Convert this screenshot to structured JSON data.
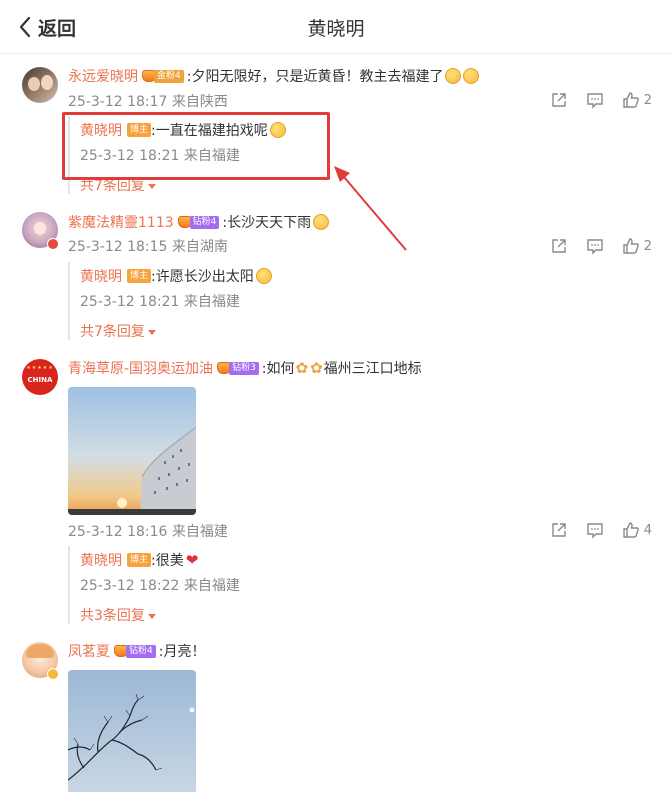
{
  "header": {
    "back_label": "返回",
    "title": "黄晓明"
  },
  "comments": [
    {
      "user": "永远爱晓明",
      "badge": "金粉4",
      "text": ":夕阳无限好，只是近黄昏！教主去福建了",
      "meta": "25-3-12 18:17 来自陕西",
      "likes": "2",
      "reply": {
        "user": "黄晓明",
        "tag": "博主",
        "text": ":一直在福建拍戏呢",
        "time": "25-3-12 18:21 来自福建"
      },
      "more": "共7条回复"
    },
    {
      "user": "紫魔法精靈1113",
      "badge": "钻粉4",
      "text": ":长沙天天下雨",
      "meta": "25-3-12 18:15 来自湖南",
      "likes": "2",
      "reply": {
        "user": "黄晓明",
        "tag": "博主",
        "text": ":许愿长沙出太阳",
        "time": "25-3-12 18:21 来自福建"
      },
      "more": "共7条回复"
    },
    {
      "user": "青海草原-国羽奥运加油",
      "badge": "钻粉3",
      "text_a": ":如何",
      "text_b": "福州三江口地标",
      "avatar_text": "CHINA",
      "meta": "25-3-12 18:16 来自福建",
      "likes": "4",
      "reply": {
        "user": "黄晓明",
        "tag": "博主",
        "text": ":很美",
        "time": "25-3-12 18:22 来自福建"
      },
      "more": "共3条回复"
    },
    {
      "user": "凤茗夏",
      "badge": "钻粉4",
      "text": ":月亮！"
    }
  ],
  "colors": {
    "username": "#eb7350",
    "highlight": "#e33a3a",
    "meta": "#8a8a8a"
  }
}
